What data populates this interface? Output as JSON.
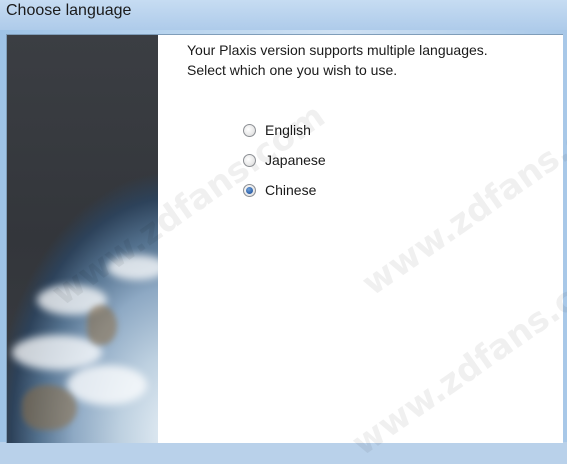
{
  "window": {
    "title": "Choose language"
  },
  "dialog": {
    "message_line1": "Your Plaxis version supports multiple languages.",
    "message_line2": "Select which one you wish to use."
  },
  "languages": [
    {
      "label": "English",
      "checked": false
    },
    {
      "label": "Japanese",
      "checked": false
    },
    {
      "label": "Chinese",
      "checked": true
    }
  ],
  "watermark_text": "www.zdfans.com"
}
